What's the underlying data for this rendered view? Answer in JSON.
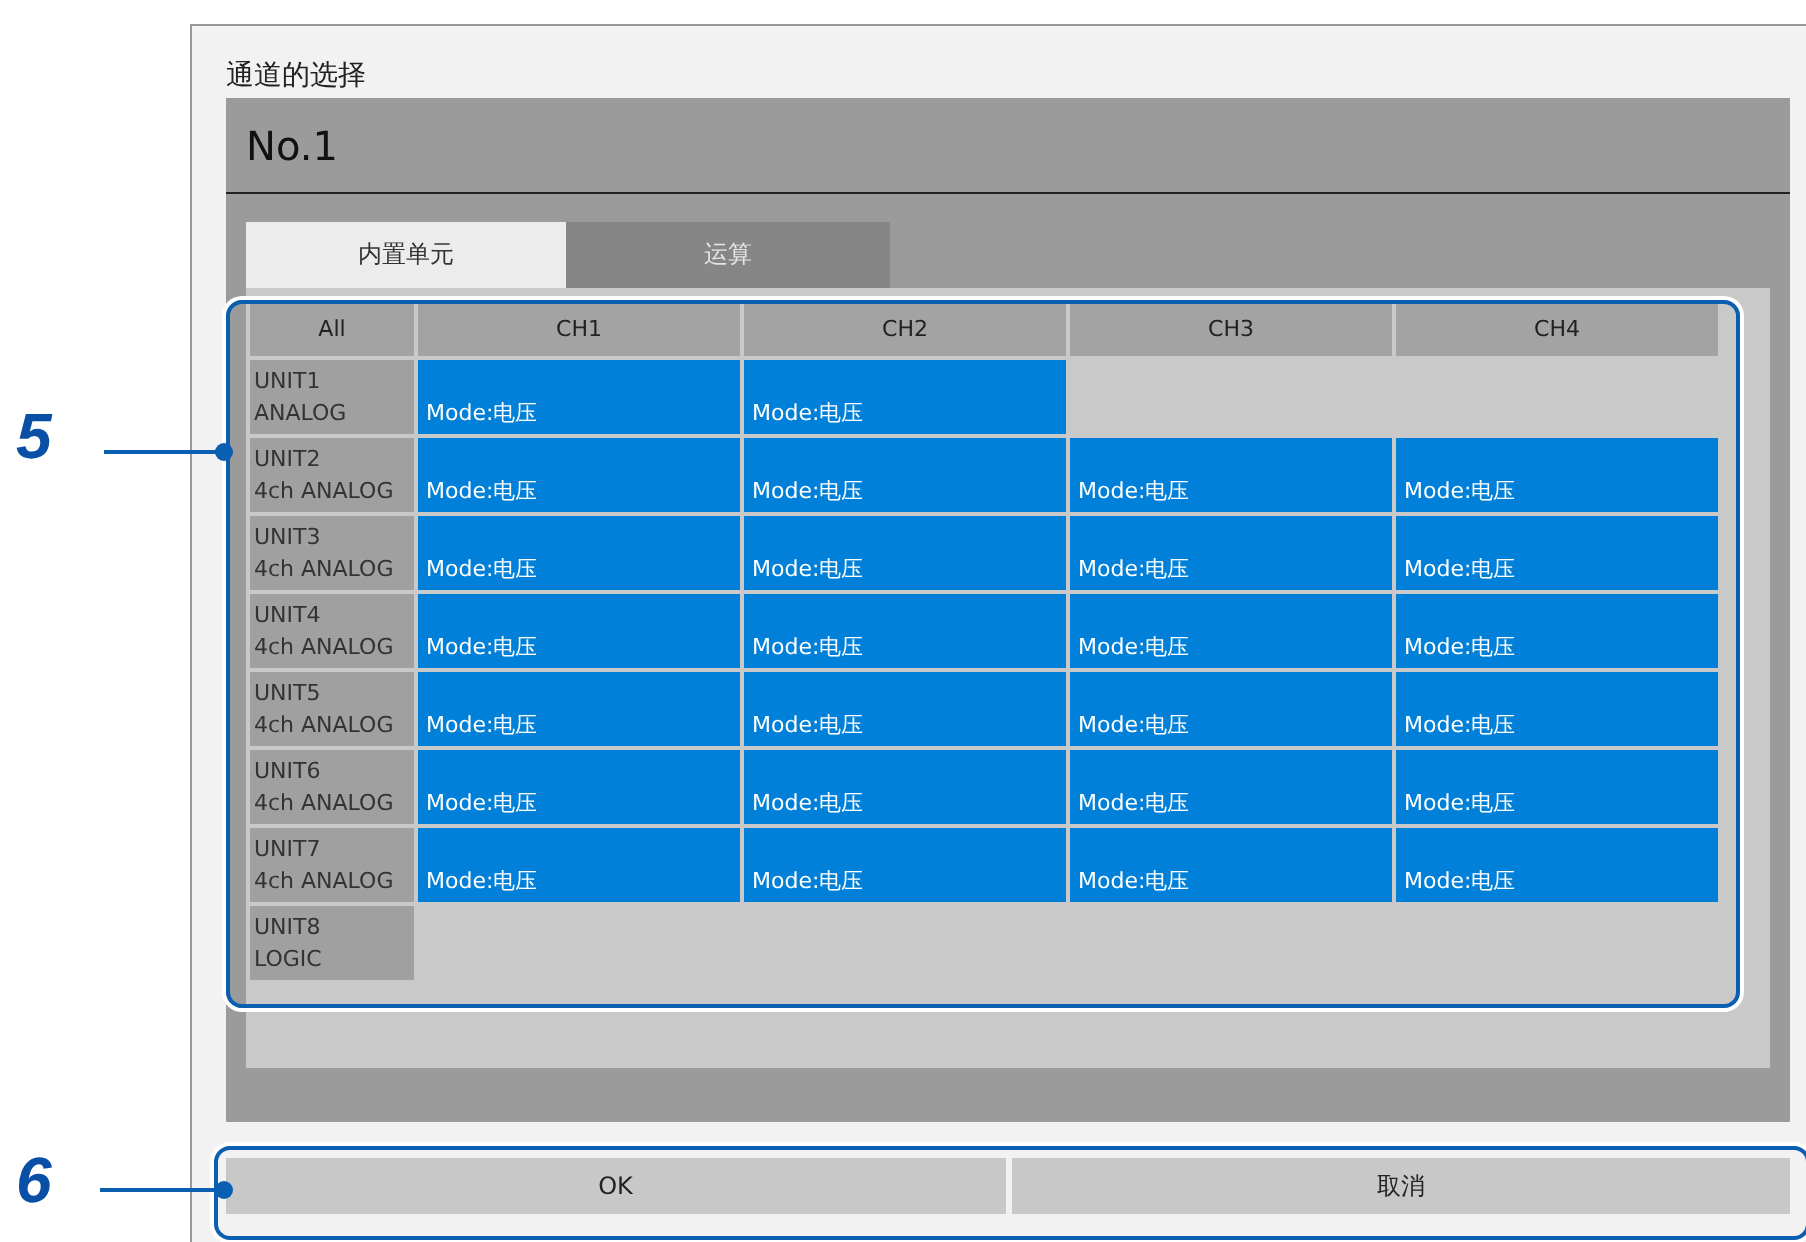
{
  "window": {
    "title": "通道的选择",
    "header": "No.1"
  },
  "tabs": [
    {
      "label": "内置单元",
      "selected": true
    },
    {
      "label": "运算",
      "selected": false
    }
  ],
  "grid": {
    "corner": "All",
    "columns": [
      "CH1",
      "CH2",
      "CH3",
      "CH4"
    ],
    "rows": [
      {
        "name": "UNIT1",
        "type": "ANALOG",
        "channels": [
          "Mode:电压",
          "Mode:电压"
        ]
      },
      {
        "name": "UNIT2",
        "type": "4ch ANALOG",
        "channels": [
          "Mode:电压",
          "Mode:电压",
          "Mode:电压",
          "Mode:电压"
        ]
      },
      {
        "name": "UNIT3",
        "type": "4ch ANALOG",
        "channels": [
          "Mode:电压",
          "Mode:电压",
          "Mode:电压",
          "Mode:电压"
        ]
      },
      {
        "name": "UNIT4",
        "type": "4ch ANALOG",
        "channels": [
          "Mode:电压",
          "Mode:电压",
          "Mode:电压",
          "Mode:电压"
        ]
      },
      {
        "name": "UNIT5",
        "type": "4ch ANALOG",
        "channels": [
          "Mode:电压",
          "Mode:电压",
          "Mode:电压",
          "Mode:电压"
        ]
      },
      {
        "name": "UNIT6",
        "type": "4ch ANALOG",
        "channels": [
          "Mode:电压",
          "Mode:电压",
          "Mode:电压",
          "Mode:电压"
        ]
      },
      {
        "name": "UNIT7",
        "type": "4ch ANALOG",
        "channels": [
          "Mode:电压",
          "Mode:电压",
          "Mode:电压",
          "Mode:电压"
        ]
      },
      {
        "name": "UNIT8",
        "type": "LOGIC",
        "channels": []
      }
    ]
  },
  "buttons": [
    "OK",
    "取消"
  ],
  "callouts": [
    {
      "label": "5",
      "kind": "grid"
    },
    {
      "label": "6",
      "kind": "buttons"
    }
  ]
}
